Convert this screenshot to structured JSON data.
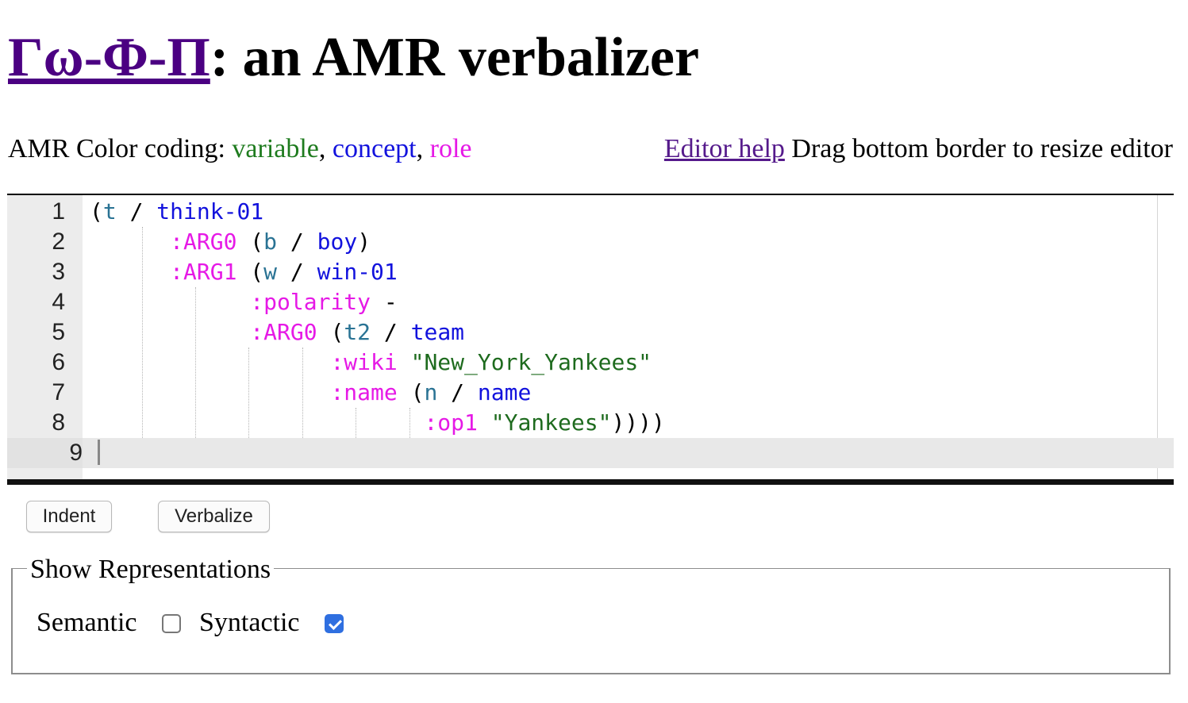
{
  "title": {
    "link_text": "Γω-Φ-Π",
    "rest": ": an AMR verbalizer"
  },
  "legend": {
    "prefix": "AMR Color coding: ",
    "variable": "variable",
    "comma1": ", ",
    "concept": "concept",
    "comma2": ", ",
    "role": "role",
    "editor_help": "Editor help",
    "resize_hint": " Drag bottom border to resize editor"
  },
  "colors": {
    "variable": "#1e7b1e",
    "concept": "#1212dd",
    "role": "#e619e6",
    "code_variable": "#2a7394",
    "string": "#1e6b1e",
    "link": "#551a8b"
  },
  "editor": {
    "lines": [
      {
        "num": "1",
        "tokens": [
          [
            "p",
            "("
          ],
          [
            "v",
            "t"
          ],
          [
            "p",
            " / "
          ],
          [
            "c",
            "think-01"
          ]
        ]
      },
      {
        "num": "2",
        "tokens": [
          [
            "p",
            "      "
          ],
          [
            "r",
            ":ARG0"
          ],
          [
            "p",
            " ("
          ],
          [
            "v",
            "b"
          ],
          [
            "p",
            " / "
          ],
          [
            "c",
            "boy"
          ],
          [
            "p",
            ")"
          ]
        ]
      },
      {
        "num": "3",
        "tokens": [
          [
            "p",
            "      "
          ],
          [
            "r",
            ":ARG1"
          ],
          [
            "p",
            " ("
          ],
          [
            "v",
            "w"
          ],
          [
            "p",
            " / "
          ],
          [
            "c",
            "win-01"
          ]
        ]
      },
      {
        "num": "4",
        "tokens": [
          [
            "p",
            "            "
          ],
          [
            "r",
            ":polarity"
          ],
          [
            "p",
            " -"
          ]
        ]
      },
      {
        "num": "5",
        "tokens": [
          [
            "p",
            "            "
          ],
          [
            "r",
            ":ARG0"
          ],
          [
            "p",
            " ("
          ],
          [
            "v",
            "t2"
          ],
          [
            "p",
            " / "
          ],
          [
            "c",
            "team"
          ]
        ]
      },
      {
        "num": "6",
        "tokens": [
          [
            "p",
            "                  "
          ],
          [
            "r",
            ":wiki"
          ],
          [
            "p",
            " "
          ],
          [
            "s",
            "\"New_York_Yankees\""
          ]
        ]
      },
      {
        "num": "7",
        "tokens": [
          [
            "p",
            "                  "
          ],
          [
            "r",
            ":name"
          ],
          [
            "p",
            " ("
          ],
          [
            "v",
            "n"
          ],
          [
            "p",
            " / "
          ],
          [
            "c",
            "name"
          ]
        ]
      },
      {
        "num": "8",
        "tokens": [
          [
            "p",
            "                         "
          ],
          [
            "r",
            ":op1"
          ],
          [
            "p",
            " "
          ],
          [
            "s",
            "\"Yankees\""
          ],
          [
            "p",
            "))))"
          ]
        ]
      },
      {
        "num": "9",
        "tokens": []
      }
    ]
  },
  "buttons": {
    "indent": "Indent",
    "verbalize": "Verbalize"
  },
  "representations": {
    "legend": "Show Representations",
    "semantic_label": "Semantic",
    "semantic_checked": false,
    "syntactic_label": "Syntactic",
    "syntactic_checked": true
  }
}
